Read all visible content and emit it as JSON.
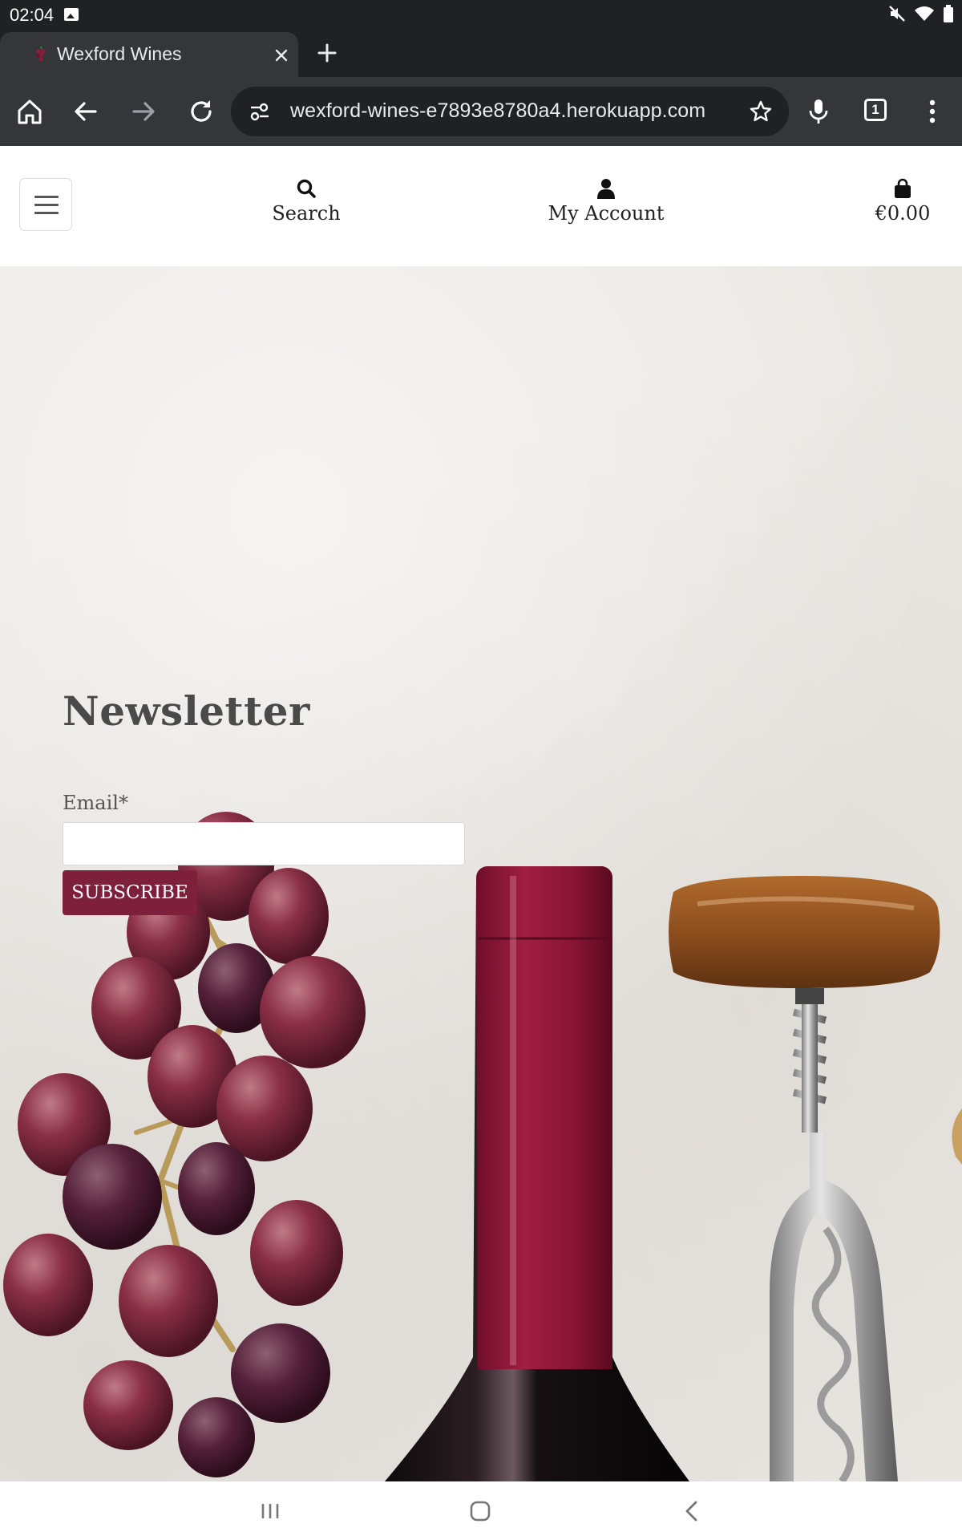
{
  "status_bar": {
    "time": "02:04"
  },
  "tab": {
    "title": "Wexford Wines"
  },
  "toolbar": {
    "url": "wexford-wines-e7893e8780a4.herokuapp.com",
    "tab_count": "1"
  },
  "header": {
    "search_label": "Search",
    "account_label": "My Account",
    "bag_total": "€0.00"
  },
  "newsletter": {
    "title": "Newsletter",
    "email_label": "Email*",
    "email_value": "",
    "subscribe_label": "SUBSCRIBE"
  },
  "colors": {
    "brand": "#7e1f3c",
    "browser_dark": "#202124",
    "browser_toolbar": "#35363a"
  }
}
